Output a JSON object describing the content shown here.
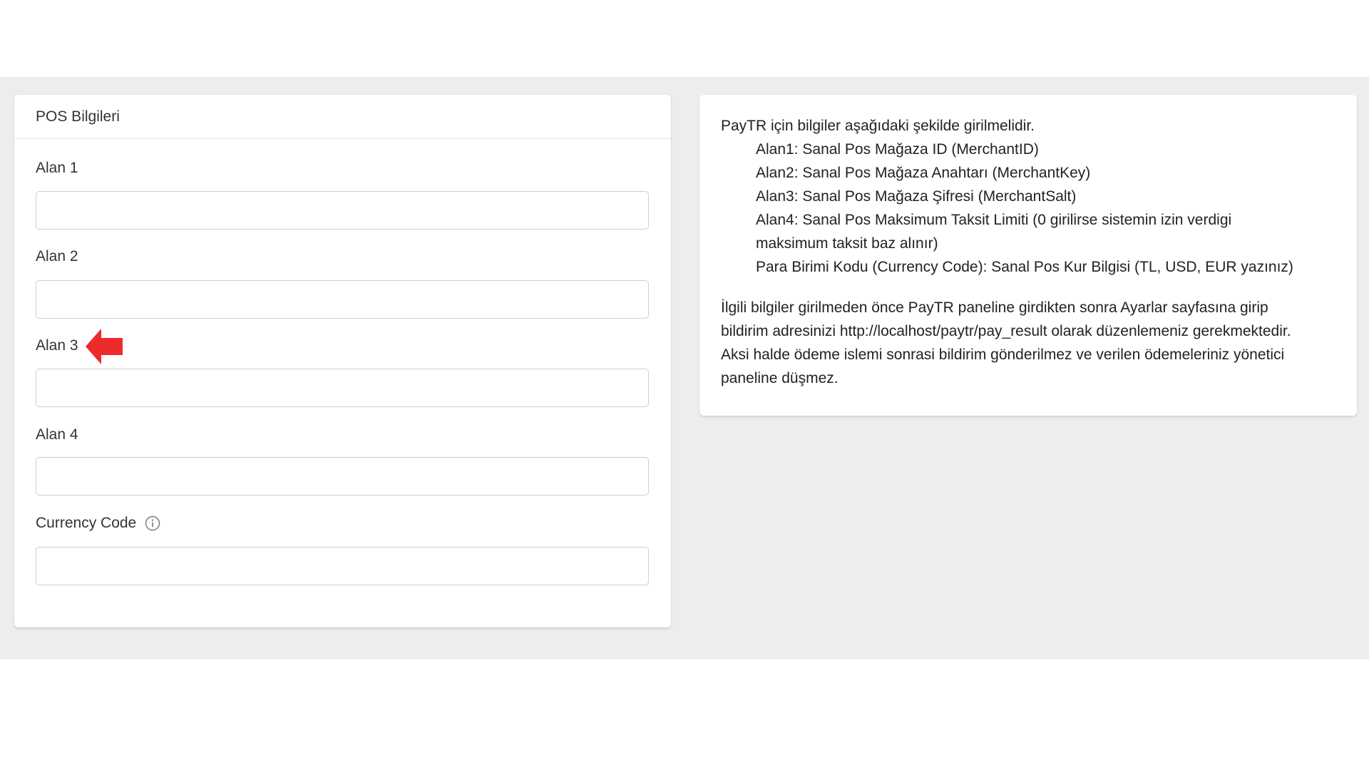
{
  "pos_card": {
    "title": "POS Bilgileri",
    "fields": [
      {
        "label": "Alan 1",
        "value": ""
      },
      {
        "label": "Alan 2",
        "value": ""
      },
      {
        "label": "Alan 3",
        "value": ""
      },
      {
        "label": "Alan 4",
        "value": ""
      },
      {
        "label": "Currency Code",
        "value": ""
      }
    ],
    "highlight_arrow_color": "#ee2b2b"
  },
  "info_card": {
    "intro": "PayTR için bilgiler aşağıdaki şekilde girilmelidir.",
    "items": [
      "Alan1: Sanal Pos Mağaza ID (MerchantID)",
      "Alan2: Sanal Pos Mağaza Anahtarı (MerchantKey)",
      "Alan3: Sanal Pos Mağaza Şifresi (MerchantSalt)",
      "Alan4: Sanal Pos Maksimum Taksit Limiti (0 girilirse sistemin izin verdigi",
      "maksimum taksit baz alınır)",
      "Para Birimi Kodu (Currency Code): Sanal Pos Kur Bilgisi (TL, USD, EUR yazınız)"
    ],
    "paragraph2": [
      "İlgili bilgiler girilmeden önce PayTR paneline girdikten sonra Ayarlar sayfasına girip",
      "bildirim adresinizi http://localhost/paytr/pay_result olarak düzenlemeniz gerekmektedir.",
      "Aksi halde ödeme islemi sonrasi bildirim gönderilmez ve verilen ödemeleriniz yönetici",
      "paneline düşmez."
    ]
  },
  "colors": {
    "background_band": "#ededed",
    "card": "#ffffff",
    "arrow": "#ee2b2b"
  }
}
